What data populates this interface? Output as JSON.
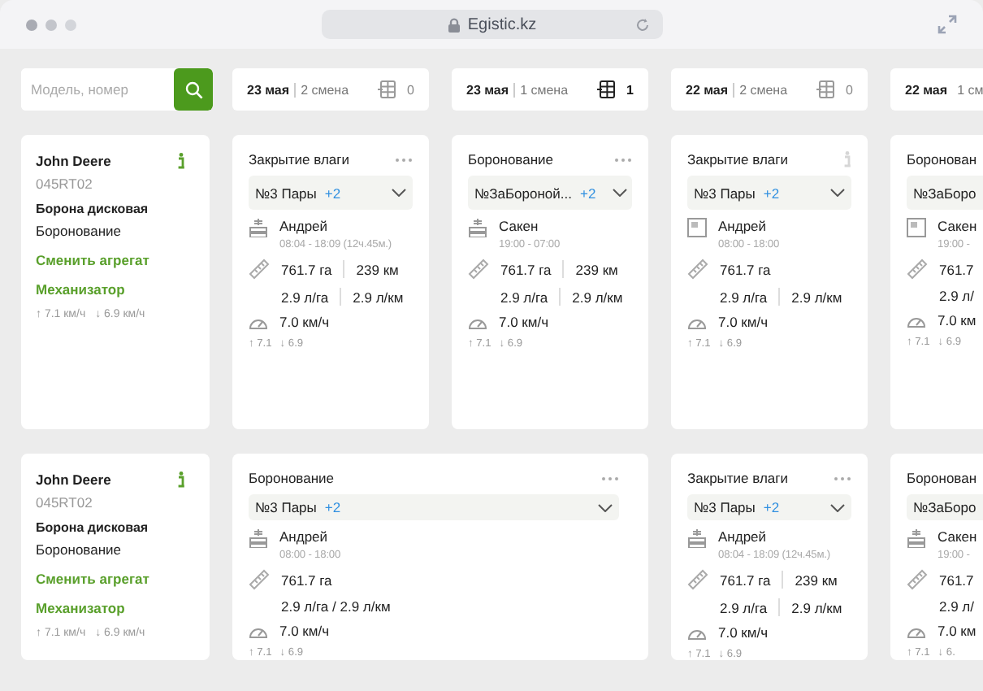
{
  "browser": {
    "address": "Egistic.kz"
  },
  "search": {
    "placeholder": "Модель, номер"
  },
  "days": [
    {
      "date": "23 мая",
      "shift": "2 смена",
      "count": "0",
      "selected": false
    },
    {
      "date": "23 мая",
      "shift": "1 смена",
      "count": "1",
      "selected": true
    },
    {
      "date": "22 мая",
      "shift": "2 смена",
      "count": "0",
      "selected": false
    },
    {
      "date": "22 мая",
      "shift": "1 см"
    }
  ],
  "machines": [
    {
      "name": "John Deere",
      "plate": "045RT02",
      "implement": "Борона дисковая",
      "operation": "Боронование",
      "links": [
        "Сменить агрегат",
        "Механизатор"
      ],
      "speed_up": "↑ 7.1 км/ч",
      "speed_down": "↓ 6.9 км/ч",
      "shifts": [
        {
          "title": "Закрытие влаги",
          "menu": true,
          "field": {
            "value": "№3 Пары",
            "extra": "+2",
            "chevron": true
          },
          "operator": "Андрей",
          "photo": false,
          "time": "08:04 - 18:09 (12ч.45м.)",
          "area": "761.7 га",
          "distance": "239 км",
          "fuel": [
            "2.9 л/га",
            "2.9 л/км"
          ],
          "speed": "7.0 км/ч",
          "max": "↑ 7.1",
          "min": "↓ 6.9"
        },
        {
          "title": "Боронование",
          "menu": true,
          "field": {
            "value": "№ЗаБороной...",
            "extra": "+2",
            "chevron": true
          },
          "operator": "Сакен",
          "photo": false,
          "time": "19:00 - 07:00",
          "area": "761.7 га",
          "distance": "239 км",
          "fuel": [
            "2.9 л/га",
            "2.9 л/км"
          ],
          "speed": "7.0 км/ч",
          "max": "↑ 7.1",
          "min": "↓ 6.9"
        },
        {
          "title": "Закрытие влаги",
          "info": true,
          "field": {
            "value": "№3 Пары",
            "extra": "+2",
            "chevron": true
          },
          "operator": "Андрей",
          "photo": true,
          "time": "08:00 - 18:00",
          "area": "761.7 га",
          "fuel": [
            "2.9 л/га",
            "2.9 л/км"
          ],
          "speed": "7.0 км/ч",
          "max": "↑ 7.1",
          "min": "↓ 6.9"
        },
        {
          "cut": true,
          "title": "Боронован",
          "field": {
            "value": "№ЗаБоро",
            "chevron": false
          },
          "operator": "Сакен",
          "photo": true,
          "time": "19:00 -",
          "area": "761.7",
          "fuel": [
            "2.9 л/"
          ],
          "speed": "7.0 км",
          "max": "↑ 7.1",
          "min": "↓ 6.9"
        }
      ]
    },
    {
      "name": "John Deere",
      "plate": "045RT02",
      "implement": "Борона дисковая",
      "operation": "Боронование",
      "links": [
        "Сменить агрегат",
        "Механизатор"
      ],
      "speed_up": "↑ 7.1 км/ч",
      "speed_down": "↓ 6.9 км/ч",
      "shifts": [
        {
          "wide": true,
          "title": "Боронование",
          "menu": true,
          "field": {
            "value": "№3 Пары",
            "extra": "+2",
            "chevron": true
          },
          "operator": "Андрей",
          "photo": false,
          "time": "08:00 - 18:00",
          "area": "761.7 га",
          "fuel": [
            "2.9 л/га / 2.9 л/км"
          ],
          "speed": "7.0 км/ч",
          "max": "↑ 7.1",
          "min": "↓ 6.9"
        },
        {
          "title": "Закрытие влаги",
          "menu": true,
          "field": {
            "value": "№3 Пары",
            "extra": "+2",
            "chevron": true
          },
          "operator": "Андрей",
          "photo": false,
          "time": "08:04 - 18:09 (12ч.45м.)",
          "area": "761.7 га",
          "distance": "239 км",
          "fuel": [
            "2.9 л/га",
            "2.9 л/км"
          ],
          "speed": "7.0 км/ч",
          "max": "↑ 7.1",
          "min": "↓ 6.9"
        },
        {
          "cut": true,
          "title": "Боронован",
          "field": {
            "value": "№ЗаБоро",
            "chevron": false
          },
          "operator": "Сакен",
          "photo": false,
          "time": "19:00 -",
          "area": "761.7",
          "fuel": [
            "2.9 л/"
          ],
          "speed": "7.0 км",
          "max": "↑ 7.1",
          "min": "↓ 6."
        }
      ]
    }
  ]
}
